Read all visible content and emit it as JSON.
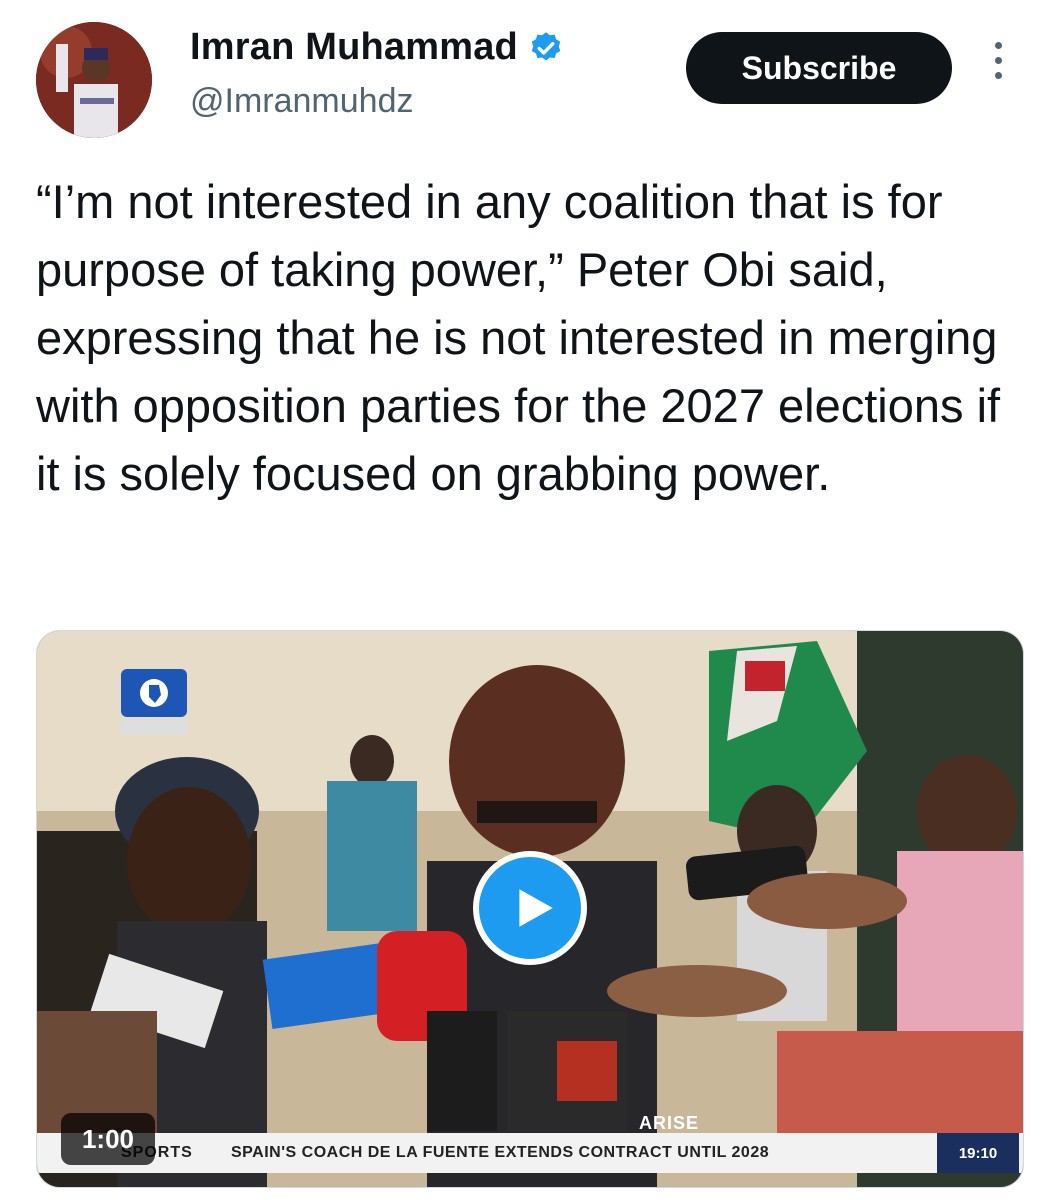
{
  "author": {
    "display_name": "Imran Muhammad",
    "handle": "@Imranmuhdz",
    "verified": true
  },
  "actions": {
    "subscribe_label": "Subscribe",
    "more_icon": "more-vertical-icon"
  },
  "tweet": {
    "text": "“I’m not interested in any coalition that is for purpose of taking power,” Peter Obi said, expressing that he is not interested in merging with opposition parties for the 2027 elections if it is solely focused on grabbing power."
  },
  "video": {
    "duration": "1:00",
    "play_icon": "play-icon",
    "ticker": {
      "section": "SPORTS",
      "headline": "SPAIN'S COACH DE LA FUENTE EXTENDS CONTRACT UNTIL 2028",
      "time": "19:10",
      "network": "ARISE"
    }
  },
  "colors": {
    "accent": "#1d9bf0",
    "subscribe_bg": "#0f1419",
    "handle_text": "#536471"
  }
}
